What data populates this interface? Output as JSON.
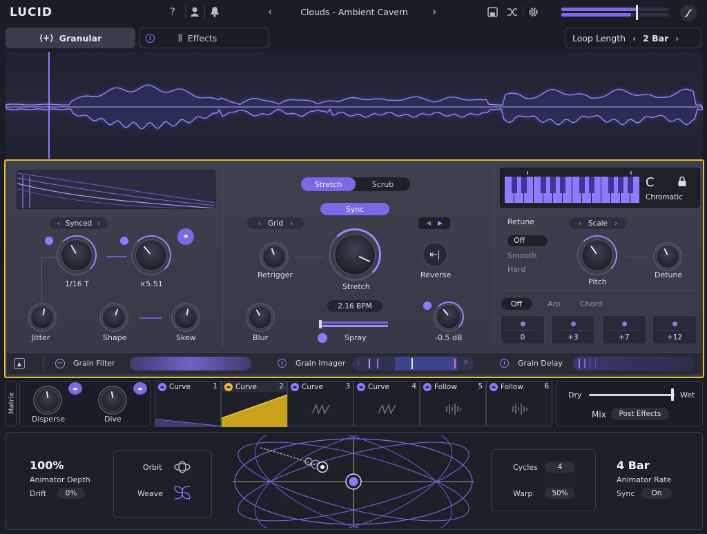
{
  "app": {
    "logo": "LUCID",
    "preset_name": "Clouds - Ambient Cavern"
  },
  "header": {
    "help": "?",
    "meter_level": 0.69
  },
  "tabs": {
    "granular": "Granular",
    "effects": "Effects"
  },
  "loop": {
    "label": "Loop Length",
    "value": "2 Bar"
  },
  "lfo": {
    "mode": "Synced",
    "rate": "1/16 T",
    "mult": "×5.51",
    "jitter": "Jitter",
    "shape": "Shape",
    "skew": "Skew"
  },
  "stretch_section": {
    "mode_stretch": "Stretch",
    "mode_scrub": "Scrub",
    "sync": "Sync",
    "grid": "Grid",
    "retrigger": "Retrigger",
    "stretch": "Stretch",
    "reverse": "Reverse",
    "bpm": "2.16 BPM",
    "blur": "Blur",
    "spray": "Spray",
    "gain": "-0.5 dB"
  },
  "pitch_section": {
    "key": "C",
    "scale_type": "Chromatic",
    "retune": "Retune",
    "retune_options": [
      "Off",
      "Smooth",
      "Hard"
    ],
    "scale": "Scale",
    "pitch": "Pitch",
    "detune": "Detune",
    "arp_tabs": [
      "Off",
      "Arp",
      "Chord"
    ],
    "arp_values": [
      "0",
      "+3",
      "+7",
      "+12"
    ]
  },
  "strip": {
    "grain_filter": "Grain Filter",
    "grain_imager": "Grain Imager",
    "grain_delay": "Grain Delay",
    "imager_l": "L",
    "imager_r": "R"
  },
  "matrix": {
    "label": "Matrix",
    "disperse": "Disperse",
    "dive": "Dive",
    "slots": [
      {
        "name": "Curve",
        "num": "1"
      },
      {
        "name": "Curve",
        "num": "2"
      },
      {
        "name": "Curve",
        "num": "3"
      },
      {
        "name": "Curve",
        "num": "4"
      },
      {
        "name": "Follow",
        "num": "5"
      },
      {
        "name": "Follow",
        "num": "6"
      }
    ],
    "dry": "Dry",
    "wet": "Wet",
    "mix": "Mix",
    "mix_mode": "Post Effects"
  },
  "animator": {
    "depth_value": "100%",
    "depth_label": "Animator Depth",
    "drift_label": "Drift",
    "drift_value": "0%",
    "orbit": "Orbit",
    "weave": "Weave",
    "cycles_label": "Cycles",
    "cycles_value": "4",
    "warp_label": "Warp",
    "warp_value": "50%",
    "rate_value": "4 Bar",
    "rate_label": "Animator Rate",
    "sync_label": "Sync",
    "sync_value": "On"
  },
  "colors": {
    "accent": "#8d7bff",
    "highlight": "#f0b832",
    "bg": "#1b1d26"
  }
}
